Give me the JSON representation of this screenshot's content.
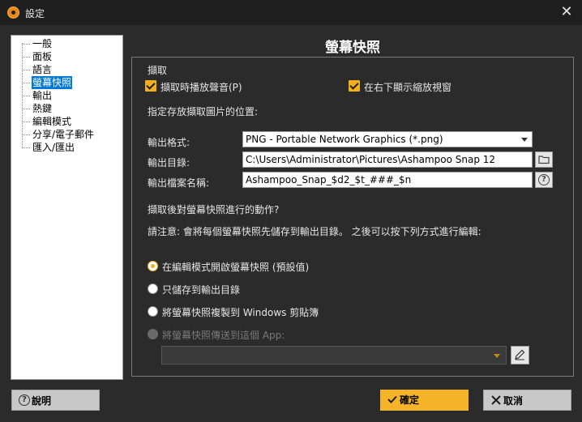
{
  "window": {
    "title": "設定",
    "close_glyph": "✕"
  },
  "nav": {
    "items": [
      {
        "label": "一般",
        "selected": false
      },
      {
        "label": "面板",
        "selected": false
      },
      {
        "label": "語言",
        "selected": false
      },
      {
        "label": "螢幕快照",
        "selected": true
      },
      {
        "label": "輸出",
        "selected": false
      },
      {
        "label": "熱鍵",
        "selected": false
      },
      {
        "label": "編輯模式",
        "selected": false
      },
      {
        "label": "分享/電子郵件",
        "selected": false
      },
      {
        "label": "匯入/匯出",
        "selected": false
      }
    ]
  },
  "panel": {
    "title": "螢幕快照",
    "capture": {
      "group_label": "擷取",
      "play_sound_label": "擷取時播放聲音(P)",
      "play_sound_checked": true,
      "show_zoom_label": "在右下顯示縮放視窗",
      "show_zoom_checked": true
    },
    "save_location_label": "指定存放擷取圖片的位置:",
    "output_format": {
      "label": "輸出格式:",
      "value": "PNG - Portable Network Graphics (*.png)"
    },
    "output_dir": {
      "label": "輸出目錄:",
      "value": "C:\\Users\\Administrator\\Pictures\\Ashampoo Snap 12"
    },
    "output_filename": {
      "label": "輸出檔案名稱:",
      "value": "Ashampoo_Snap_$d2_$t_###_$n",
      "help_glyph": "?"
    },
    "after_capture_label": "擷取後對螢幕快照進行的動作?",
    "note": "請注意: 會將每個螢幕快照先儲存到輸出目錄。 之後可以按下列方式進行編輯:",
    "actions": [
      {
        "label": "在編輯模式開啟螢幕快照 (預設值)",
        "checked": true,
        "disabled": false
      },
      {
        "label": "只儲存到輸出目錄",
        "checked": false,
        "disabled": false
      },
      {
        "label": "將螢幕快照複製到 Windows 剪貼簿",
        "checked": false,
        "disabled": false
      },
      {
        "label": "將螢幕快照傳送到這個 App:",
        "checked": false,
        "disabled": true
      }
    ],
    "app_select_value": ""
  },
  "buttons": {
    "help": "說明",
    "ok": "確定",
    "cancel": "取消"
  },
  "colors": {
    "accent": "#f4b328",
    "selection": "#0078d7",
    "background": "#2b2b2b"
  }
}
